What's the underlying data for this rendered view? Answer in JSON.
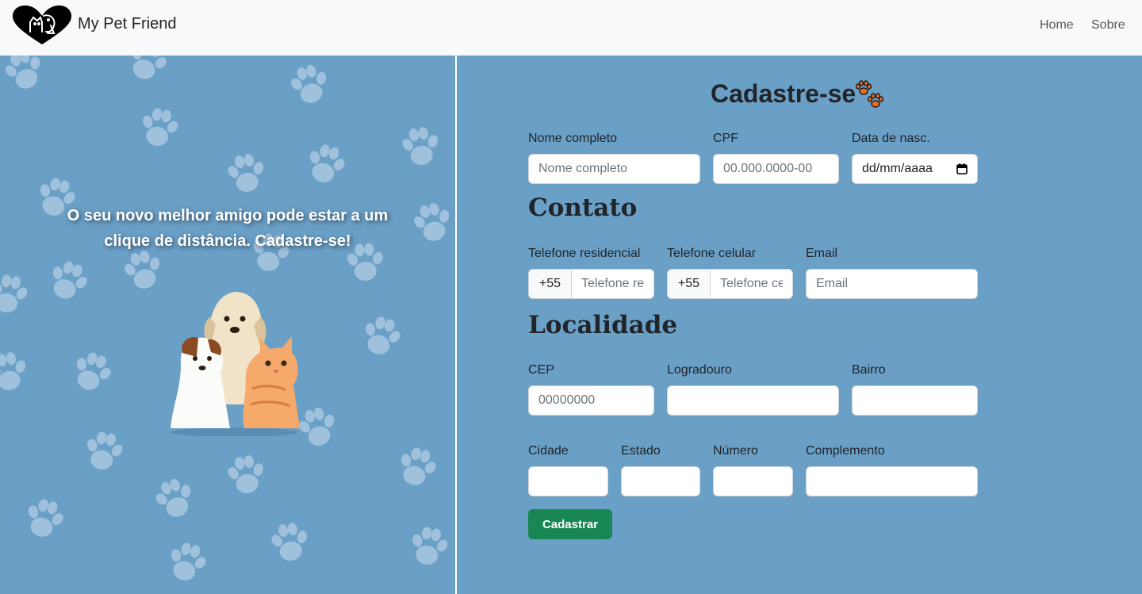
{
  "navbar": {
    "brand": "My Pet Friend",
    "links": [
      "Home",
      "Sobre"
    ]
  },
  "hero": {
    "tagline": "O seu novo melhor amigo pode estar a um clique de distância. Cadastre-se!"
  },
  "form": {
    "title": "Cadastre-se",
    "fields": {
      "name": {
        "label": "Nome completo",
        "placeholder": "Nome completo"
      },
      "cpf": {
        "label": "CPF",
        "placeholder": "00.000.0000-00"
      },
      "birth": {
        "label": "Data de nasc.",
        "placeholder": "dd/mm/aaaa"
      }
    },
    "contact": {
      "heading": "Contato",
      "home_phone": {
        "label": "Telefone residencial",
        "prefix": "+55",
        "placeholder": "Telefone residencial"
      },
      "mobile_phone": {
        "label": "Telefone celular",
        "prefix": "+55",
        "placeholder": "Telefone celular"
      },
      "email": {
        "label": "Email",
        "placeholder": "Email"
      }
    },
    "location": {
      "heading": "Localidade",
      "cep": {
        "label": "CEP",
        "placeholder": "00000000"
      },
      "street": {
        "label": "Logradouro"
      },
      "district": {
        "label": "Bairro"
      },
      "city": {
        "label": "Cidade"
      },
      "state": {
        "label": "Estado"
      },
      "number": {
        "label": "Número"
      },
      "complement": {
        "label": "Complemento"
      }
    },
    "submit_label": "Cadastrar"
  },
  "colors": {
    "background": "#6a9fc6",
    "navbar": "#f8f9fa",
    "submit": "#198754",
    "paw_orange": "#f06a1e"
  },
  "icons": {
    "logo": "heart-pets-logo-icon",
    "title_icon": "paw-prints-icon",
    "date_picker": "calendar-icon"
  }
}
